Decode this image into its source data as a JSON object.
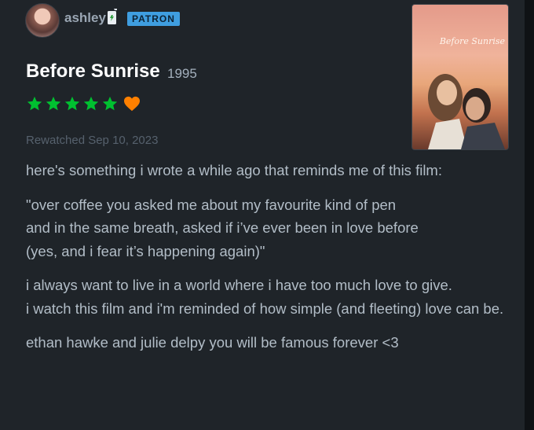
{
  "reviewer": {
    "username": "ashley",
    "badge": "PATRON"
  },
  "film": {
    "title": "Before Sunrise",
    "year": "1995",
    "rating_stars": 5,
    "liked": true,
    "poster_title": "Before Sunrise"
  },
  "watch_date": "Rewatched Sep 10, 2023",
  "review": {
    "para1": "here's something i wrote a while ago that reminds me of this film:",
    "para2_line1": "\"over coffee you asked me about my favourite kind of pen",
    "para2_line2": "and in the same breath, asked if i’ve ever been in love before",
    "para2_line3": "(yes, and i fear it’s happening again)\"",
    "para3_line1": "i always want to live in a world where i have too much love to give.",
    "para3_line2": "i watch this film and i'm reminded of how simple (and fleeting) love can be.",
    "para4": "ethan hawke and julie delpy you will be famous forever <3"
  },
  "colors": {
    "background": "#1f2429",
    "star_green": "#00c030",
    "heart_orange": "#ff8000",
    "patron_blue": "#3f9ee0"
  },
  "icons": [
    "drink-icon",
    "star-icon",
    "heart-icon"
  ]
}
